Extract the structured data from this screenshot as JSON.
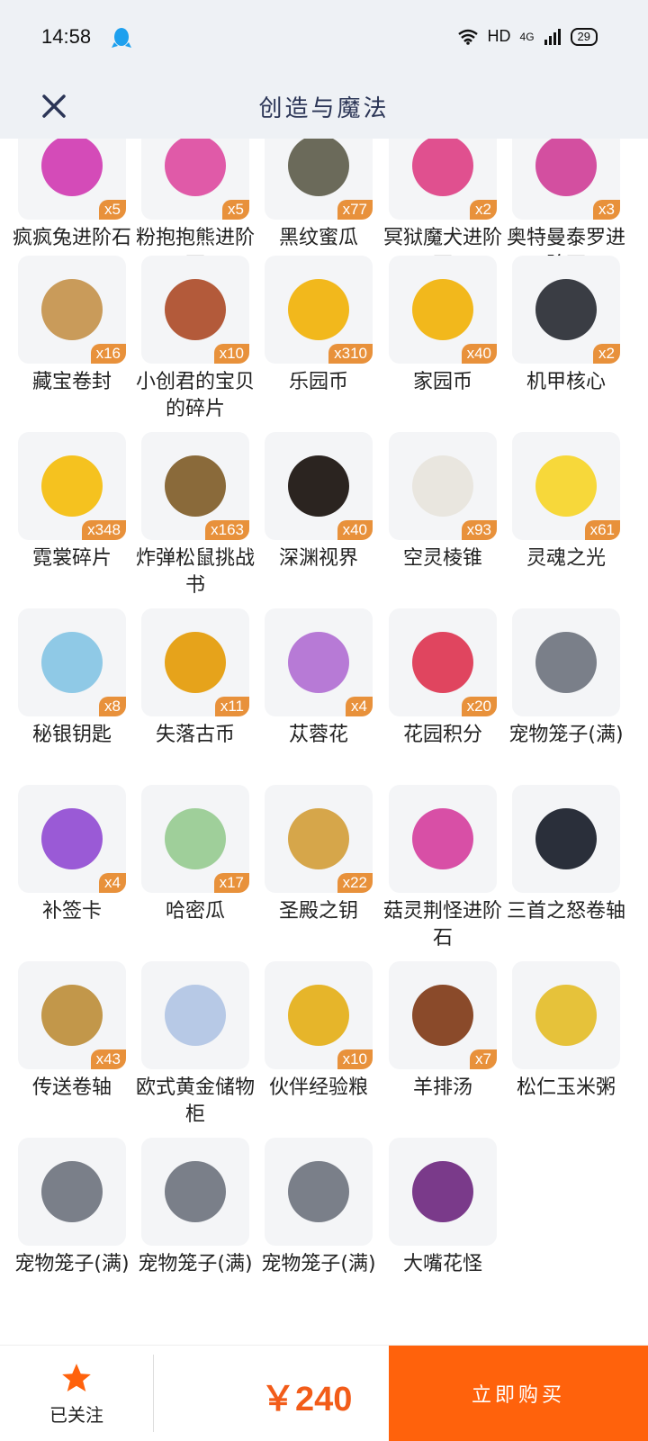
{
  "status": {
    "time": "14:58",
    "signal_text": "HD",
    "network": "4G",
    "battery": "29"
  },
  "header": {
    "title": "创造与魔法"
  },
  "items": [
    {
      "name": "疯疯兔进阶石",
      "qty": "x5",
      "color": "#d44bb8"
    },
    {
      "name": "粉抱抱熊进阶石",
      "qty": "x5",
      "color": "#e05aa8"
    },
    {
      "name": "黑纹蜜瓜",
      "qty": "x77",
      "color": "#6b6a5a"
    },
    {
      "name": "冥狱魔犬进阶石",
      "qty": "x2",
      "color": "#e0508f"
    },
    {
      "name": "奥特曼泰罗进阶石",
      "qty": "x3",
      "color": "#d34fa0"
    },
    {
      "name": "藏宝卷封",
      "qty": "x16",
      "color": "#c99b5a"
    },
    {
      "name": "小创君的宝贝的碎片",
      "qty": "x10",
      "color": "#b35a3a"
    },
    {
      "name": "乐园币",
      "qty": "x310",
      "color": "#f2b81c"
    },
    {
      "name": "家园币",
      "qty": "x40",
      "color": "#f2b81c"
    },
    {
      "name": "机甲核心",
      "qty": "x2",
      "color": "#3a3d44"
    },
    {
      "name": "霓裳碎片",
      "qty": "x348",
      "color": "#f5c21f"
    },
    {
      "name": "炸弹松鼠挑战书",
      "qty": "x163",
      "color": "#8a6a3a"
    },
    {
      "name": "深渊视界",
      "qty": "x40",
      "color": "#2b2420"
    },
    {
      "name": "空灵棱锥",
      "qty": "x93",
      "color": "#e9e6df"
    },
    {
      "name": "灵魂之光",
      "qty": "x61",
      "color": "#f7d83a"
    },
    {
      "name": "秘银钥匙",
      "qty": "x8",
      "color": "#8fc9e6"
    },
    {
      "name": "失落古币",
      "qty": "x11",
      "color": "#e6a31b"
    },
    {
      "name": "苁蓉花",
      "qty": "x4",
      "color": "#b77ad6"
    },
    {
      "name": "花园积分",
      "qty": "x20",
      "color": "#e0455f"
    },
    {
      "name": "宠物笼子(满)",
      "qty": "",
      "color": "#7a7f89"
    },
    {
      "name": "补签卡",
      "qty": "x4",
      "color": "#9a5ad6"
    },
    {
      "name": "哈密瓜",
      "qty": "x17",
      "color": "#9fcf9a"
    },
    {
      "name": "圣殿之钥",
      "qty": "x22",
      "color": "#d6a64a"
    },
    {
      "name": "菇灵荆怪进阶石",
      "qty": "",
      "color": "#d84fa6"
    },
    {
      "name": "三首之怒卷轴",
      "qty": "",
      "color": "#2a2f3a"
    },
    {
      "name": "传送卷轴",
      "qty": "x43",
      "color": "#c2974a"
    },
    {
      "name": "欧式黄金储物柜",
      "qty": "",
      "color": "#b7c9e6"
    },
    {
      "name": "伙伴经验粮",
      "qty": "x10",
      "color": "#e6b52a"
    },
    {
      "name": "羊排汤",
      "qty": "x7",
      "color": "#8a4a2a"
    },
    {
      "name": "松仁玉米粥",
      "qty": "",
      "color": "#e6c23a"
    },
    {
      "name": "宠物笼子(满)",
      "qty": "",
      "color": "#7a7f89"
    },
    {
      "name": "宠物笼子(满)",
      "qty": "",
      "color": "#7a7f89"
    },
    {
      "name": "宠物笼子(满)",
      "qty": "",
      "color": "#7a7f89"
    },
    {
      "name": "大嘴花怪",
      "qty": "",
      "color": "#7a3a8a"
    }
  ],
  "footer": {
    "follow_label": "已关注",
    "price": "￥240",
    "buy_label": "立即购买"
  },
  "colors": {
    "accent": "#ff620c",
    "qty_badge": "#e8913b"
  }
}
